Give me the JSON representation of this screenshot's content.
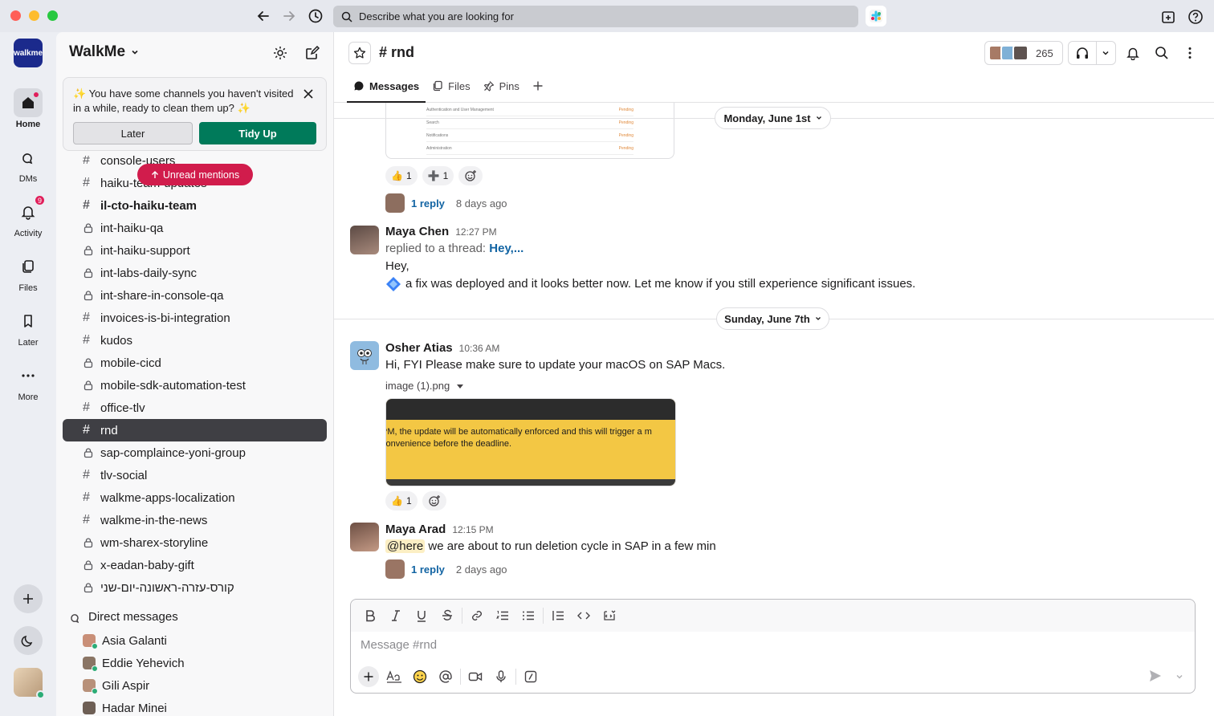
{
  "app": {
    "search_placeholder": "Describe what you are looking for",
    "workspace_logo": "walkme"
  },
  "rail": {
    "items": [
      {
        "label": "Home"
      },
      {
        "label": "DMs"
      },
      {
        "label": "Activity",
        "badge": "9"
      },
      {
        "label": "Files"
      },
      {
        "label": "Later"
      },
      {
        "label": "More"
      }
    ]
  },
  "sidebar": {
    "workspace": "WalkMe",
    "banner": {
      "text": "✨ You have some channels you haven't visited in a while, ready to clean them up? ✨",
      "later": "Later",
      "tidy": "Tidy Up"
    },
    "unread_pill": "Unread mentions",
    "channels": [
      {
        "name": "console-users",
        "type": "public"
      },
      {
        "name": "haiku-team-updates",
        "type": "public"
      },
      {
        "name": "il-cto-haiku-team",
        "type": "public",
        "bold": true
      },
      {
        "name": "int-haiku-qa",
        "type": "private"
      },
      {
        "name": "int-haiku-support",
        "type": "private"
      },
      {
        "name": "int-labs-daily-sync",
        "type": "private"
      },
      {
        "name": "int-share-in-console-qa",
        "type": "private"
      },
      {
        "name": "invoices-is-bi-integration",
        "type": "public"
      },
      {
        "name": "kudos",
        "type": "public"
      },
      {
        "name": "mobile-cicd",
        "type": "private"
      },
      {
        "name": "mobile-sdk-automation-test",
        "type": "private"
      },
      {
        "name": "office-tlv",
        "type": "public"
      },
      {
        "name": "rnd",
        "type": "public",
        "selected": true
      },
      {
        "name": "sap-complaince-yoni-group",
        "type": "private"
      },
      {
        "name": "tlv-social",
        "type": "public"
      },
      {
        "name": "walkme-apps-localization",
        "type": "public"
      },
      {
        "name": "walkme-in-the-news",
        "type": "public"
      },
      {
        "name": "wm-sharex-storyline",
        "type": "private"
      },
      {
        "name": "x-eadan-baby-gift",
        "type": "private"
      },
      {
        "name": "קורס-עזרה-ראשונה-יום-שני",
        "type": "private"
      }
    ],
    "dm_header": "Direct messages",
    "dms": [
      {
        "name": "Asia Galanti",
        "color": "#c98f78"
      },
      {
        "name": "Eddie Yehevich",
        "color": "#8a7565"
      },
      {
        "name": "Gili Aspir",
        "color": "#b8917a"
      },
      {
        "name": "Hadar Minei",
        "color": "#6e5f55"
      }
    ]
  },
  "channel": {
    "title": "# rnd",
    "member_count": "265",
    "tabs": [
      {
        "label": "Messages"
      },
      {
        "label": "Files"
      },
      {
        "label": "Pins"
      }
    ]
  },
  "messages": {
    "date1": "Monday, June 1st",
    "first_reactions": [
      {
        "emoji": "👍",
        "count": "1"
      },
      {
        "emoji": "➕",
        "count": "1"
      }
    ],
    "first_thread": {
      "replies": "1 reply",
      "ago": "8 days ago"
    },
    "img_rows": [
      "Authentication and User Management",
      "Search",
      "Notifications",
      "Administration"
    ],
    "img_status": "Pending",
    "m1": {
      "name": "Maya Chen",
      "time": "12:27 PM",
      "replied": "replied to a thread:",
      "thread_link": "Hey,...",
      "line1": "Hey,",
      "line2": "a fix was deployed and it looks better now. Let me know if you still experience significant issues."
    },
    "date2": "Sunday, June 7th",
    "m2": {
      "name": "Osher Atias",
      "time": "10:36 AM",
      "text": "Hi, FYI Please make sure to update your macOS on SAP Macs.",
      "file": "image (1).png",
      "img_line1": "PM, the update will be automatically enforced and this will trigger a m",
      "img_line2": "convenience before the deadline.",
      "reaction": {
        "emoji": "👍",
        "count": "1"
      }
    },
    "m3": {
      "name": "Maya Arad",
      "time": "12:15 PM",
      "mention": "@here",
      "text": "we are about to run deletion cycle in SAP in a few min",
      "thread": {
        "replies": "1 reply",
        "ago": "2 days ago"
      }
    }
  },
  "composer": {
    "placeholder": "Message #rnd"
  }
}
